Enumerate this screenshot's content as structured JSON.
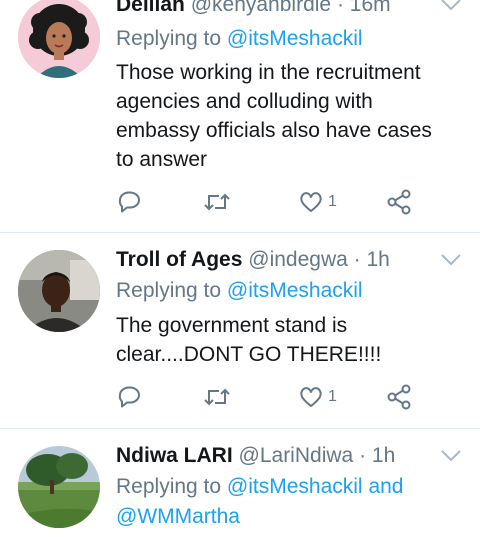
{
  "tweets": [
    {
      "name": "Delilah",
      "handle": "@kenyanbirdie",
      "separator": "·",
      "time": "16m",
      "replying_prefix": "Replying to",
      "replying_to": "@itsMeshackil",
      "replying_and": "",
      "replying_to2": "",
      "text_lines": [
        "Those working in the recruitment",
        "agencies and colluding with",
        "embassy officials  also have cases",
        "to answer"
      ],
      "likes": "1",
      "avatar_icon": "woman-curly-hair-avatar"
    },
    {
      "name": "Troll of Ages",
      "handle": "@indegwa",
      "separator": "·",
      "time": "1h",
      "replying_prefix": "Replying to",
      "replying_to": "@itsMeshackil",
      "replying_and": "",
      "replying_to2": "",
      "text_lines": [
        "The government stand is",
        "clear....DONT GO THERE!!!!"
      ],
      "likes": "1",
      "avatar_icon": "man-photo-avatar"
    },
    {
      "name": "Ndiwa LARI",
      "handle": "@LariNdiwa",
      "separator": "·",
      "time": "1h",
      "replying_prefix": "Replying to",
      "replying_to": "@itsMeshackil",
      "replying_and": "and",
      "replying_to2": "@WMMartha",
      "text_lines": [],
      "likes": "",
      "avatar_icon": "landscape-tree-avatar"
    }
  ],
  "colors": {
    "name": "#14171a",
    "secondary": "#657786",
    "link": "#1da1f2",
    "divider": "#e1e8ed"
  }
}
